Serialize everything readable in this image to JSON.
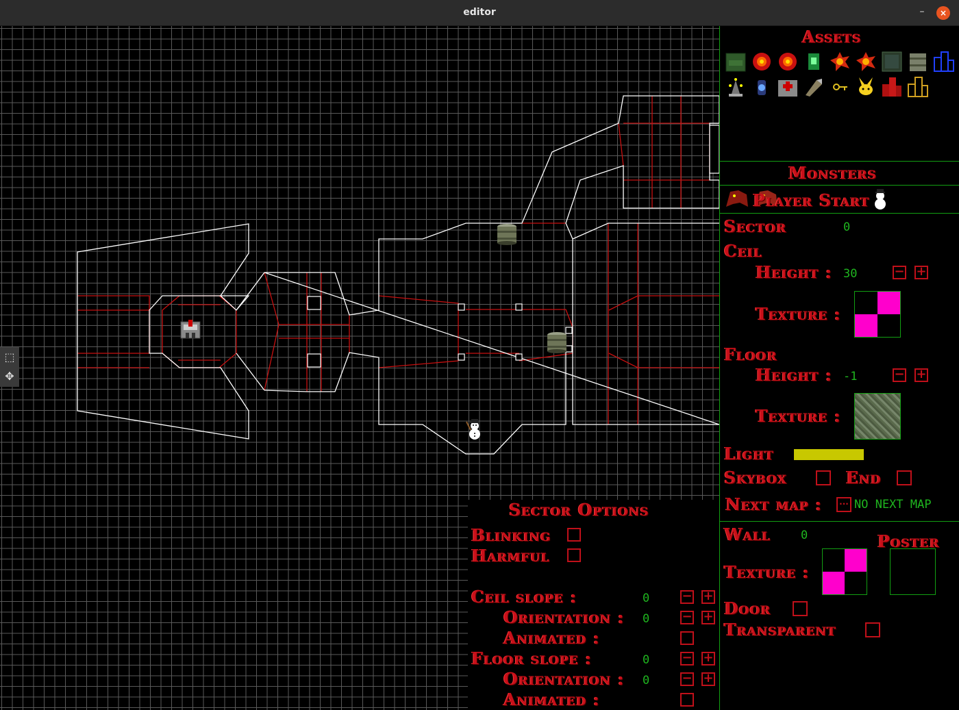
{
  "window": {
    "title": "editor",
    "minimize_label": "–",
    "close_label": "×"
  },
  "colors": {
    "grid": "#5a5a5a",
    "wall": "#ffffff",
    "portal": "#c81010",
    "doom_red": "#c8101a",
    "value_green": "#1fb51f",
    "sidebar_border": "#12a012",
    "light_bar": "#c8c800"
  },
  "tools": {
    "select_icon": "⬚",
    "move_icon": "✥"
  },
  "assets": {
    "title": "Assets",
    "items": [
      "ammo-box",
      "red-orb",
      "red-orb-2",
      "green-armor",
      "explosion",
      "explosion-2",
      "green-door",
      "barrel",
      "blue-building",
      "candelabra",
      "lantern",
      "medkit",
      "rocket",
      "key",
      "pikachu",
      "red-building",
      "yellow-building"
    ]
  },
  "monsters": {
    "title": "Monsters",
    "player_start_label": "Player Start"
  },
  "sector": {
    "label": "Sector",
    "id": "0",
    "ceil": {
      "label": "Ceil",
      "height_label": "Height :",
      "height": "30",
      "texture_label": "Texture :"
    },
    "floor": {
      "label": "Floor",
      "height_label": "Height :",
      "height": "-1",
      "texture_label": "Texture :"
    },
    "light_label": "Light",
    "light_level": 1.0,
    "skybox_label": "Skybox",
    "end_label": "End",
    "next_map_label": "Next map :",
    "next_map_button": "···",
    "next_map_value": "NO NEXT MAP"
  },
  "wall": {
    "label": "Wall",
    "id": "0",
    "texture_label": "Texture :",
    "poster_label": "Poster",
    "door_label": "Door",
    "transparent_label": "Transparent"
  },
  "sector_options": {
    "title": "Sector Options",
    "blinking_label": "Blinking",
    "harmful_label": "Harmful",
    "ceil_slope_label": "Ceil slope :",
    "ceil_slope": "0",
    "ceil_orientation_label": "Orientation :",
    "ceil_orientation": "0",
    "ceil_animated_label": "Animated :",
    "floor_slope_label": "Floor slope :",
    "floor_slope": "0",
    "floor_orientation_label": "Orientation :",
    "floor_orientation": "0",
    "floor_animated_label": "Animated :"
  },
  "buttons": {
    "minus": "−",
    "plus": "+"
  }
}
